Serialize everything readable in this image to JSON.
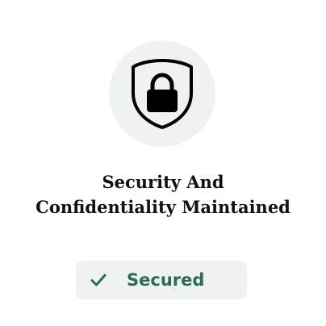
{
  "title": {
    "line1": "Security And",
    "line2": "Confidentiality Maintained"
  },
  "status_badge": {
    "icon": "check-icon",
    "label": "Secured",
    "color": "#2f6b4f"
  },
  "hero": {
    "icon": "shield-lock-icon"
  },
  "colors": {
    "icon_bg": "#eef3f1",
    "badge_bg": "#eef3f1",
    "text": "#111111"
  }
}
